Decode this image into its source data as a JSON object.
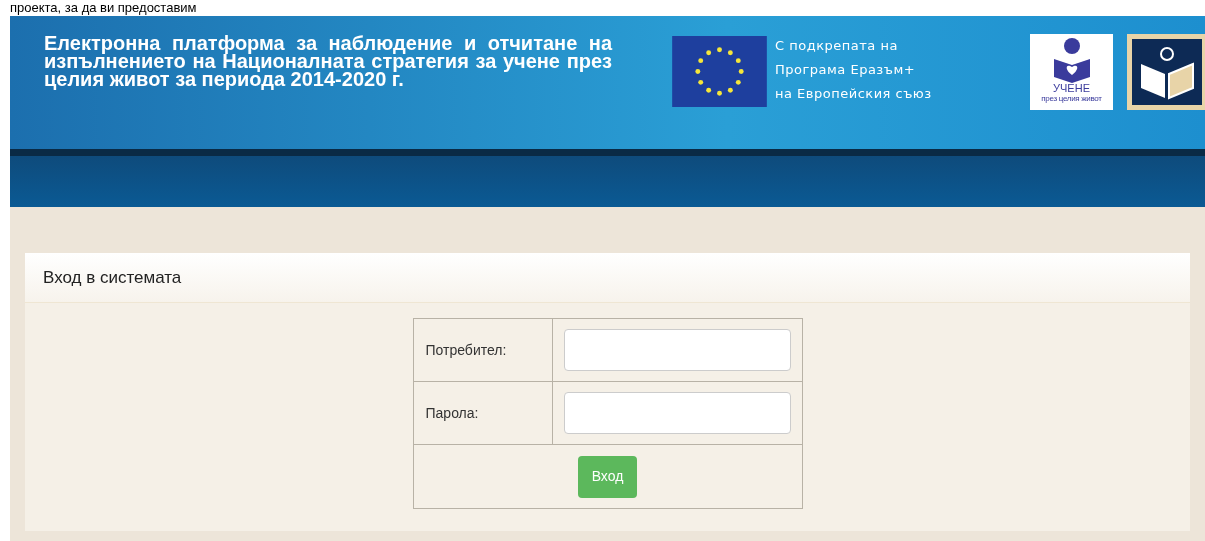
{
  "top_text": "проекта, за да ви предоставим",
  "header": {
    "title": "Електронна платформа за наблюдение и отчитане на изпълнението на Националната стратегия за учене през целия живот за периода 2014-2020 г.",
    "support_lines": [
      "С подкрепата на",
      "Програма Еразъм+",
      "на Европейския съюз"
    ],
    "logo_word": "УЧЕНЕ",
    "logo_subtitle": "през целия живот"
  },
  "login": {
    "heading": "Вход в системата",
    "fields": [
      {
        "label": "Потребител:"
      },
      {
        "label": "Парола:"
      }
    ],
    "button": "Вход"
  }
}
